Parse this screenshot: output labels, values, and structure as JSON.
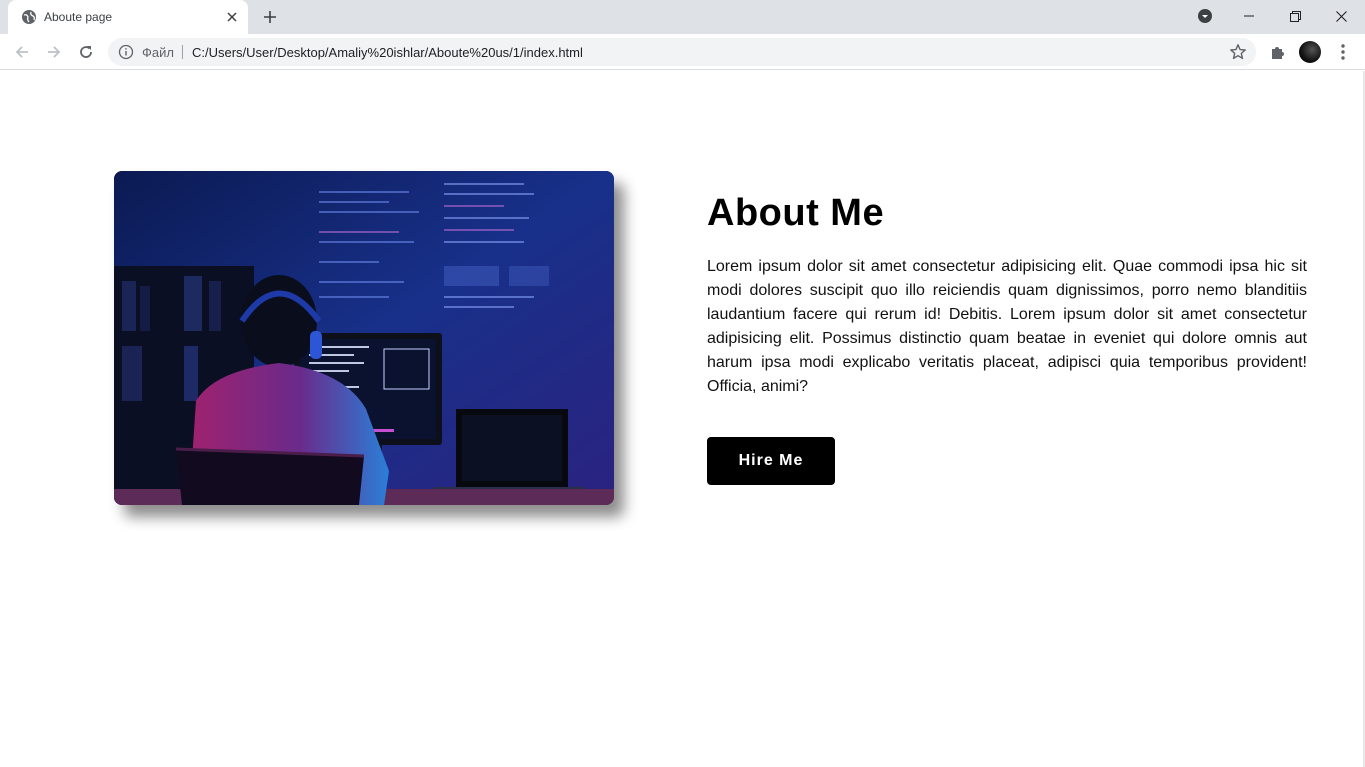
{
  "browser": {
    "tab_title": "Aboute page",
    "file_label": "Файл",
    "url": "C:/Users/User/Desktop/Amaliy%20ishlar/Aboute%20us/1/index.html"
  },
  "about": {
    "title": "About Me",
    "text": "Lorem ipsum dolor sit amet consectetur adipisicing elit. Quae commodi ipsa hic sit modi dolores suscipit quo illo reiciendis quam dignissimos, porro nemo blanditiis laudantium facere qui rerum id! Debitis. Lorem ipsum dolor sit amet consectetur adipisicing elit. Possimus distinctio quam beatae in eveniet qui dolore omnis aut harum ipsa modi explicabo veritatis placeat, adipisci quia temporibus provident! Officia, animi?",
    "button_label": "Hire Me"
  },
  "colors": {
    "button_bg": "#000000",
    "button_text": "#ffffff",
    "photo_tone": "#1b2f86"
  }
}
